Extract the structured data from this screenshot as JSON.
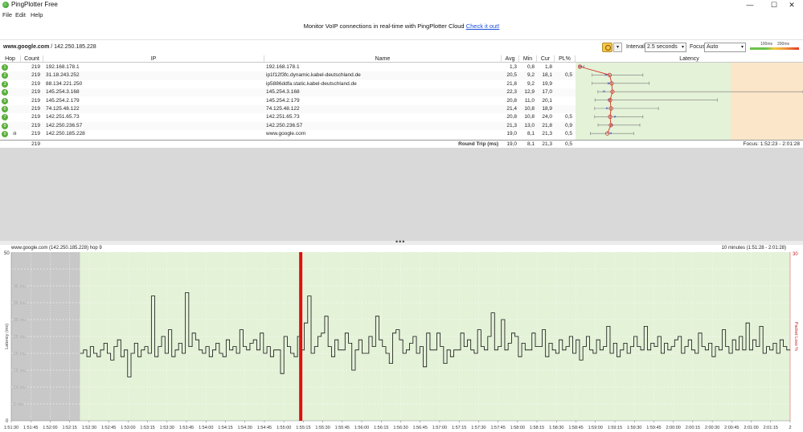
{
  "window": {
    "title": "PingPlotter Free",
    "minimize": "—",
    "maximize": "☐",
    "close": "✕"
  },
  "menu": [
    "File",
    "Edit",
    "Help"
  ],
  "promo": {
    "text": "Monitor VoIP connections in real-time with PingPlotter Cloud",
    "link": "Check it out!"
  },
  "target": {
    "host": "www.google.com",
    "ip": " / 142.250.185.228"
  },
  "controls": {
    "interval_label": "Interval",
    "interval_value": "2.5 seconds",
    "focus_label": "Focus",
    "focus_value": "Auto",
    "legend_100": "100ms",
    "legend_200": "200ms"
  },
  "table": {
    "headers": [
      "Hop",
      "Count",
      "IP",
      "Name",
      "Avg",
      "Min",
      "Cur",
      "PL%",
      "Latency"
    ],
    "latency_scale_min": "0 ms",
    "latency_scale_max": "147 ms",
    "hops": [
      {
        "hop": "1",
        "count": "219",
        "ip": "192.168.178.1",
        "name": "192.168.178.1",
        "avg": "1,3",
        "min": "0,8",
        "cur": "1,8",
        "pl": "",
        "avg_ms": 1.3,
        "min_ms": 0.8,
        "cur_ms": 1.8,
        "max_ms": 4
      },
      {
        "hop": "2",
        "count": "219",
        "ip": "31.18.243.252",
        "name": "ip1f12f3fc.dynamic.kabel-deutschland.de",
        "avg": "20,5",
        "min": "9,2",
        "cur": "18,1",
        "pl": "0,5",
        "avg_ms": 20.5,
        "min_ms": 9.2,
        "cur_ms": 18.1,
        "max_ms": 42
      },
      {
        "hop": "3",
        "count": "219",
        "ip": "88.134.221.250",
        "name": "ip5886ddfa.static.kabel-deutschland.de",
        "avg": "21,8",
        "min": "9,2",
        "cur": "19,9",
        "pl": "",
        "avg_ms": 21.8,
        "min_ms": 9.2,
        "cur_ms": 19.9,
        "max_ms": 46
      },
      {
        "hop": "4",
        "count": "219",
        "ip": "145.254.3.168",
        "name": "145.254.3.168",
        "avg": "22,3",
        "min": "12,9",
        "cur": "17,0",
        "pl": "",
        "avg_ms": 22.3,
        "min_ms": 12.9,
        "cur_ms": 17.0,
        "max_ms": 150
      },
      {
        "hop": "5",
        "count": "219",
        "ip": "145.254.2.179",
        "name": "145.254.2.179",
        "avg": "20,8",
        "min": "11,0",
        "cur": "20,1",
        "pl": "",
        "avg_ms": 20.8,
        "min_ms": 11.0,
        "cur_ms": 20.1,
        "max_ms": 90
      },
      {
        "hop": "6",
        "count": "219",
        "ip": "74.125.48.122",
        "name": "74.125.48.122",
        "avg": "21,4",
        "min": "10,8",
        "cur": "18,9",
        "pl": "",
        "avg_ms": 21.4,
        "min_ms": 10.8,
        "cur_ms": 18.9,
        "max_ms": 52
      },
      {
        "hop": "7",
        "count": "219",
        "ip": "142.251.65.73",
        "name": "142.251.65.73",
        "avg": "20,8",
        "min": "10,8",
        "cur": "24,0",
        "pl": "0,5",
        "avg_ms": 20.8,
        "min_ms": 10.8,
        "cur_ms": 24.0,
        "max_ms": 42
      },
      {
        "hop": "8",
        "count": "219",
        "ip": "142.250.236.57",
        "name": "142.250.236.57",
        "avg": "21,3",
        "min": "13,0",
        "cur": "21,8",
        "pl": "0,9",
        "avg_ms": 21.3,
        "min_ms": 13.0,
        "cur_ms": 21.8,
        "max_ms": 40
      },
      {
        "hop": "9",
        "count": "219",
        "ip": "142.250.185.228",
        "name": "www.google.com",
        "avg": "19,0",
        "min": "8,1",
        "cur": "21,3",
        "pl": "0,5",
        "avg_ms": 19.0,
        "min_ms": 8.1,
        "cur_ms": 21.3,
        "max_ms": 36
      }
    ],
    "summary": {
      "count": "219",
      "label": "Round Trip (ms)",
      "avg": "19,0",
      "min": "8,1",
      "cur": "21,3",
      "pl": "0,5",
      "focus": "Focus: 1:52:23 - 2:01:28"
    }
  },
  "graph": {
    "title": "www.google.com (142.250.185.228) hop 9",
    "range": "10 minutes (1:51:28 - 2:01:28)",
    "ylabel": "Latency (ms)",
    "y2label": "Packet Loss %",
    "y_top": "50",
    "y_zero": "0",
    "y2_top": "30",
    "y_ticks": [
      "40 ms",
      "35 ms",
      "30 ms",
      "25 ms",
      "20 ms",
      "15 ms",
      "10 ms",
      "5 ms"
    ],
    "x_ticks": [
      "1:51:30",
      "1:51:45",
      "1:52:00",
      "1:52:15",
      "1:52:30",
      "1:52:45",
      "1:53:00",
      "1:53:15",
      "1:53:30",
      "1:53:45",
      "1:54:00",
      "1:54:15",
      "1:54:30",
      "1:54:45",
      "1:55:00",
      "1:55:15",
      "1:55:30",
      "1:55:45",
      "1:56:00",
      "1:56:15",
      "1:56:30",
      "1:56:45",
      "1:57:00",
      "1:57:15",
      "1:57:30",
      "1:57:45",
      "1:58:00",
      "1:58:15",
      "1:58:30",
      "1:58:45",
      "1:59:00",
      "1:59:15",
      "1:59:30",
      "1:59:45",
      "2:00:00",
      "2:00:15",
      "2:00:30",
      "2:00:45",
      "2:01:00",
      "2:01:15",
      "2"
    ],
    "colors": {
      "good": "#e4f2d8",
      "grey": "#c8c8c8",
      "loss": "#e01010",
      "line": "#111111"
    }
  },
  "chart_data": {
    "type": "line",
    "ylabel": "Latency (ms)",
    "ylim": [
      0,
      50
    ],
    "x_start": "1:52:23",
    "x_interval_seconds": 2.5,
    "loss_marker": "1:55:13",
    "values": [
      20,
      21,
      19,
      22,
      20,
      19,
      21,
      23,
      20,
      18,
      22,
      24,
      19,
      21,
      13,
      20,
      23,
      19,
      21,
      22,
      20,
      37,
      19,
      22,
      25,
      20,
      27,
      19,
      21,
      23,
      20,
      38,
      22,
      26,
      24,
      21,
      20,
      22,
      19,
      21,
      23,
      20,
      19,
      24,
      21,
      22,
      20,
      27,
      22,
      21,
      23,
      24,
      21,
      26,
      20,
      22,
      19,
      21,
      21,
      14,
      25,
      22,
      20,
      19,
      25,
      21,
      29,
      37,
      20,
      22,
      25,
      26,
      31,
      22,
      19,
      24,
      21,
      21,
      26,
      23,
      15,
      21,
      24,
      20,
      20,
      25,
      22,
      31,
      24,
      22,
      20,
      17,
      26,
      27,
      24,
      20,
      21,
      23,
      25,
      20,
      22,
      16,
      26,
      21,
      21,
      26,
      22,
      17,
      21,
      19,
      21,
      21,
      26,
      22,
      24,
      21,
      20,
      27,
      22,
      21,
      25,
      32,
      21,
      22,
      30,
      21,
      23,
      26,
      25,
      19,
      23,
      21,
      21,
      26,
      22,
      22,
      27,
      19,
      23,
      21,
      20,
      24,
      21,
      22,
      25,
      20,
      24,
      18,
      22,
      25,
      21,
      20,
      24,
      21,
      22,
      28,
      20,
      23,
      19,
      21,
      23,
      20,
      22,
      25,
      22,
      21,
      28,
      21,
      23,
      22,
      25,
      20,
      23,
      21,
      22,
      24,
      25,
      20,
      22,
      24,
      21,
      20,
      26,
      22,
      21,
      23,
      19,
      22,
      21,
      27,
      22,
      20,
      24,
      21,
      25,
      21,
      29,
      21,
      24,
      22,
      28,
      20,
      22,
      21,
      23,
      20,
      24,
      22,
      21
    ]
  }
}
